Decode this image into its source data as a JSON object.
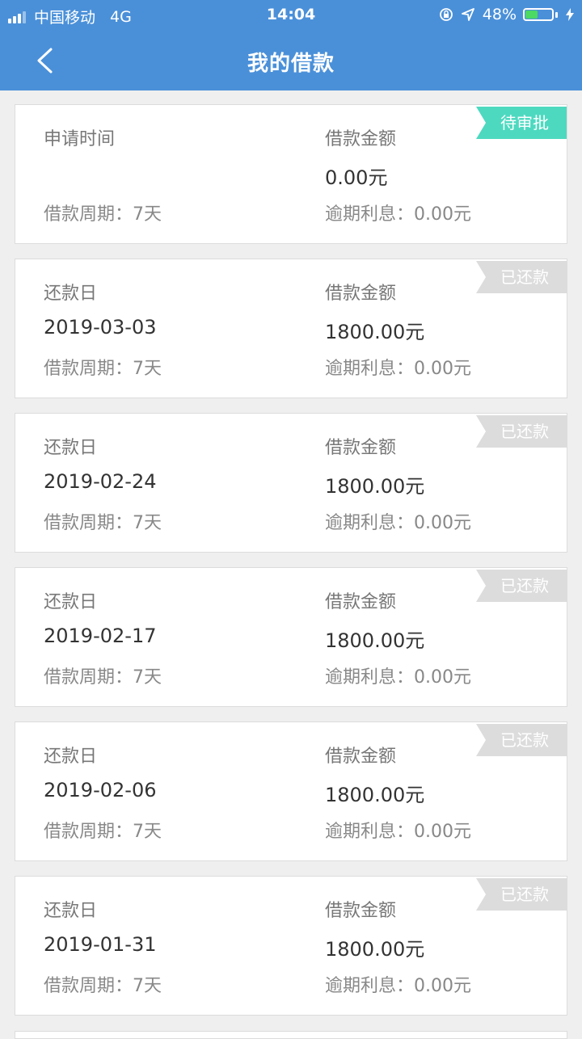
{
  "status_bar": {
    "carrier": "中国移动",
    "network": "4G",
    "time": "14:04",
    "battery_percent": "48%",
    "battery_level": 0.48,
    "icons": [
      "signal-icon",
      "orientation-lock-icon",
      "location-arrow-icon",
      "battery-icon",
      "charging-bolt-icon"
    ]
  },
  "nav": {
    "title": "我的借款",
    "back_icon": "chevron-left-icon"
  },
  "colors": {
    "header_bg": "#4a90d9",
    "tag_pending": "#4dd9c0",
    "tag_repaid": "#dcdcdc",
    "battery_fill": "#4cd964"
  },
  "loans": [
    {
      "date_label": "申请时间",
      "date_value": "",
      "amount_label": "借款金额",
      "amount_value": "0.00元",
      "period": "借款周期：7天",
      "interest": "逾期利息：0.00元",
      "status": "待审批",
      "status_type": "pending"
    },
    {
      "date_label": "还款日",
      "date_value": "2019-03-03",
      "amount_label": "借款金额",
      "amount_value": "1800.00元",
      "period": "借款周期：7天",
      "interest": "逾期利息：0.00元",
      "status": "已还款",
      "status_type": "repaid"
    },
    {
      "date_label": "还款日",
      "date_value": "2019-02-24",
      "amount_label": "借款金额",
      "amount_value": "1800.00元",
      "period": "借款周期：7天",
      "interest": "逾期利息：0.00元",
      "status": "已还款",
      "status_type": "repaid"
    },
    {
      "date_label": "还款日",
      "date_value": "2019-02-17",
      "amount_label": "借款金额",
      "amount_value": "1800.00元",
      "period": "借款周期：7天",
      "interest": "逾期利息：0.00元",
      "status": "已还款",
      "status_type": "repaid"
    },
    {
      "date_label": "还款日",
      "date_value": "2019-02-06",
      "amount_label": "借款金额",
      "amount_value": "1800.00元",
      "period": "借款周期：7天",
      "interest": "逾期利息：0.00元",
      "status": "已还款",
      "status_type": "repaid"
    },
    {
      "date_label": "还款日",
      "date_value": "2019-01-31",
      "amount_label": "借款金额",
      "amount_value": "1800.00元",
      "period": "借款周期：7天",
      "interest": "逾期利息：0.00元",
      "status": "已还款",
      "status_type": "repaid"
    }
  ]
}
